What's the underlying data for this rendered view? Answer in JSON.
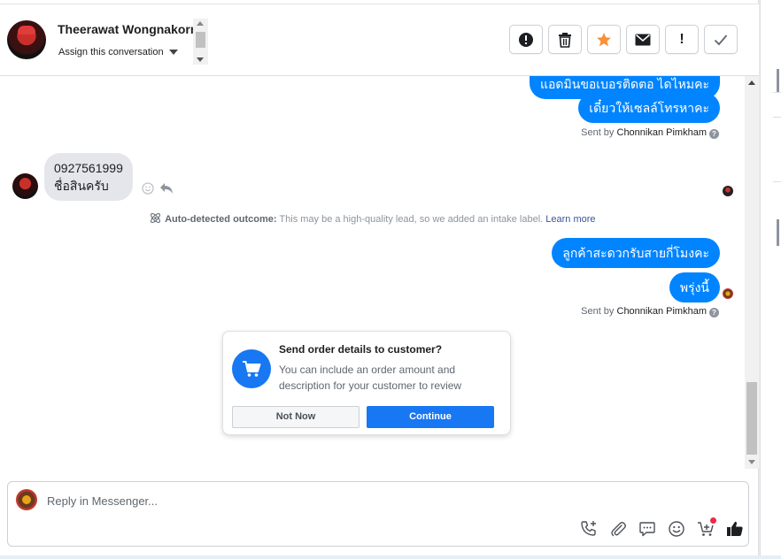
{
  "header": {
    "contact_name": "Theerawat Wongnakorn",
    "assign_label": "Assign this conversation",
    "actions": [
      {
        "name": "mark-spam-button",
        "icon": "alert-circle-icon"
      },
      {
        "name": "delete-button",
        "icon": "trash-icon"
      },
      {
        "name": "star-button",
        "icon": "star-icon"
      },
      {
        "name": "mark-unread-button",
        "icon": "envelope-icon"
      },
      {
        "name": "follow-up-button",
        "icon": "exclamation-icon"
      },
      {
        "name": "mark-done-button",
        "icon": "checkmark-icon"
      }
    ],
    "follow_up_label": "!"
  },
  "messages": {
    "out_partial": "แอดมินขอเบอรติดตอ ไดไหมคะ",
    "out_1": "เดี๋ยวให้เซลล์โทรหาคะ",
    "sent_by_prefix": "Sent by",
    "sent_by_name": "Chonnikan Pimkham",
    "help_glyph": "?",
    "in_line_1": "0927561999",
    "in_line_2": "ชื่อสินครับ",
    "outcome_bold": "Auto-detected outcome:",
    "outcome_text": " This may be a high-quality lead, so we added an intake label.",
    "outcome_link": "Learn more",
    "out_2": "ลูกค้าสะดวกรับสายกี่โมงคะ",
    "out_3": "พรุ่งนี้",
    "sent_by_prefix_2": "Sent by",
    "sent_by_name_2": "Chonnikan Pimkham"
  },
  "order_card": {
    "title": "Send order details to customer?",
    "description": "You can include an order amount and description for your customer to review",
    "not_now": "Not Now",
    "continue": "Continue"
  },
  "composer": {
    "placeholder": "Reply in Messenger..."
  },
  "colors": {
    "accent": "#1877f2",
    "bubble_out": "#0084ff",
    "bubble_in": "#e4e6eb",
    "star": "#f7923a",
    "notification": "#f02849"
  }
}
